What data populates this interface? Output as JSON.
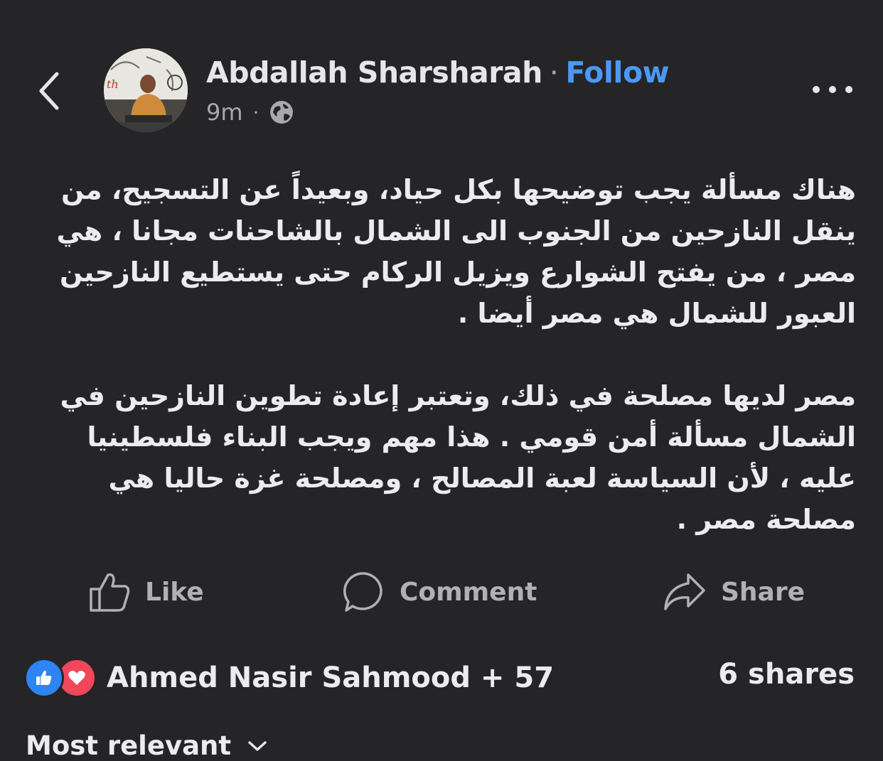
{
  "header": {
    "back_icon": "chevron-left-icon",
    "author_name": "Abdallah Sharsharah",
    "separator": "·",
    "follow_label": "Follow",
    "time": "9m",
    "meta_separator": "·",
    "audience_icon": "globe-icon",
    "more_icon": "more-horizontal-icon"
  },
  "post": {
    "paragraphs": [
      "هناك مسألة يجب توضيحها بكل حياد، وبعيداً عن التسجيح، من ينقل النازحين من الجنوب الى الشمال بالشاحنات مجانا ، هي مصر ، من يفتح الشوارع ويزيل الركام حتى يستطيع النازحين العبور للشمال هي مصر أيضا .",
      "مصر لديها مصلحة في ذلك، وتعتبر إعادة تطوين النازحين في الشمال مسألة أمن قومي . هذا مهم ويجب البناء فلسطينيا عليه ، لأن السياسة لعبة المصالح ، ومصلحة غزة حاليا هي مصلحة مصر ."
    ]
  },
  "actions": {
    "like_label": "Like",
    "comment_label": "Comment",
    "share_label": "Share"
  },
  "reactions": {
    "icons": [
      "like-reaction-icon",
      "love-reaction-icon"
    ],
    "summary": "Ahmed Nasir Sahmood + 57",
    "shares": "6 shares"
  },
  "comments": {
    "sort_label": "Most relevant"
  },
  "colors": {
    "background": "#252527",
    "text": "#ececee",
    "muted": "#a8a8ad",
    "follow": "#4c98f4",
    "like": "#2e84f3",
    "love": "#f0475a"
  }
}
